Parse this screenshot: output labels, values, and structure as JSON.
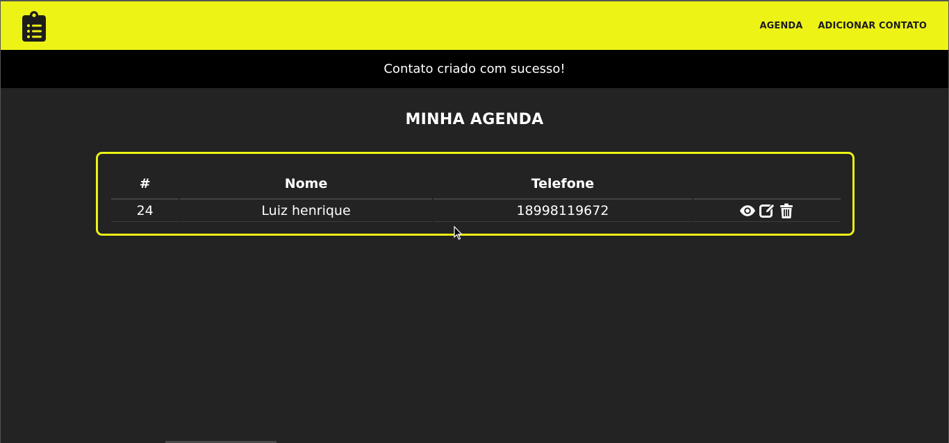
{
  "navbar": {
    "logo_icon": "clipboard-list-icon",
    "links": [
      {
        "label": "AGENDA"
      },
      {
        "label": "ADICIONAR CONTATO"
      }
    ],
    "background": "#eef316"
  },
  "flash": {
    "message": "Contato criado com sucesso!"
  },
  "page_title": "MINHA AGENDA",
  "table": {
    "headers": [
      "#",
      "Nome",
      "Telefone",
      ""
    ],
    "rows": [
      {
        "id": "24",
        "nome": "Luiz henrique",
        "telefone": "18998119672",
        "actions": [
          "eye-icon",
          "edit-icon",
          "trash-icon"
        ]
      }
    ]
  },
  "colors": {
    "accent": "#eef316",
    "background": "#232323",
    "flash_background": "#000000"
  }
}
